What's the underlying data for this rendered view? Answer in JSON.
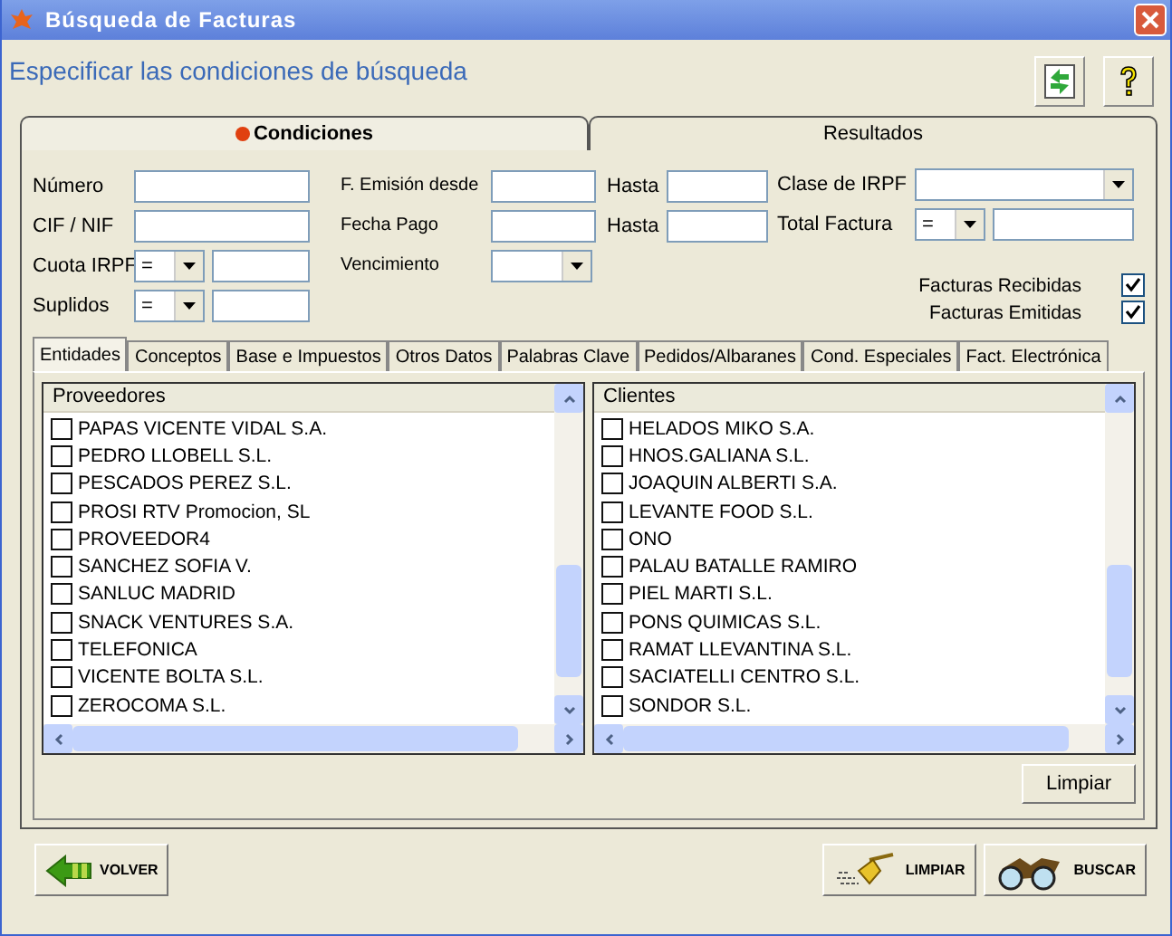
{
  "window": {
    "title": "Búsqueda de Facturas"
  },
  "header": {
    "title": "Especificar las condiciones de búsqueda"
  },
  "tabs": [
    {
      "label": "Condiciones",
      "selected": true
    },
    {
      "label": "Resultados",
      "selected": false
    }
  ],
  "criteria": {
    "column_1": [
      {
        "label": "Número",
        "kind": "text"
      },
      {
        "label": "CIF / NIF",
        "kind": "text"
      },
      {
        "label": "Cuota IRPF",
        "kind": "operator",
        "operator": "="
      },
      {
        "label": "Suplidos",
        "kind": "operator",
        "operator": "="
      }
    ],
    "column_2": [
      {
        "label": "F. Emisión desde",
        "kind": "range",
        "to_label": "Hasta"
      },
      {
        "label": "Fecha Pago",
        "kind": "range",
        "to_label": "Hasta"
      },
      {
        "label": "Vencimiento",
        "kind": "dropdown"
      }
    ],
    "column_3": [
      {
        "label": "Clase de IRPF",
        "kind": "dropdown"
      },
      {
        "label": "Total Factura",
        "kind": "operator",
        "operator": "="
      }
    ],
    "checks": [
      {
        "label": "Facturas Recibidas",
        "checked": true
      },
      {
        "label": "Facturas Emitidas",
        "checked": true
      }
    ]
  },
  "subtabs": [
    {
      "label": "Entidades",
      "selected": true
    },
    {
      "label": "Conceptos",
      "selected": false
    },
    {
      "label": "Base e Impuestos",
      "selected": false
    },
    {
      "label": "Otros Datos",
      "selected": false
    },
    {
      "label": "Palabras Clave",
      "selected": false
    },
    {
      "label": "Pedidos/Albaranes",
      "selected": false
    },
    {
      "label": "Cond. Especiales",
      "selected": false
    },
    {
      "label": "Fact. Electrónica",
      "selected": false
    }
  ],
  "lists": [
    {
      "header": "Proveedores",
      "items": [
        {
          "label": "PAPAS VICENTE VIDAL S.A.",
          "checked": false
        },
        {
          "label": "PEDRO LLOBELL S.L.",
          "checked": false
        },
        {
          "label": "PESCADOS PEREZ S.L.",
          "checked": false
        },
        {
          "label": "PROSI RTV Promocion, SL",
          "checked": false
        },
        {
          "label": "PROVEEDOR4",
          "checked": false
        },
        {
          "label": "SANCHEZ  SOFIA V.",
          "checked": false
        },
        {
          "label": "SANLUC MADRID",
          "checked": false
        },
        {
          "label": "SNACK VENTURES S.A.",
          "checked": false
        },
        {
          "label": "TELEFONICA",
          "checked": false
        },
        {
          "label": "VICENTE BOLTA S.L.",
          "checked": false
        },
        {
          "label": "ZEROCOMA S.L.",
          "checked": false
        }
      ]
    },
    {
      "header": "Clientes",
      "items": [
        {
          "label": "HELADOS MIKO S.A.",
          "checked": false
        },
        {
          "label": "HNOS.GALIANA S.L.",
          "checked": false
        },
        {
          "label": "JOAQUIN ALBERTI S.A.",
          "checked": false
        },
        {
          "label": "LEVANTE FOOD S.L.",
          "checked": false
        },
        {
          "label": "ONO",
          "checked": false
        },
        {
          "label": "PALAU BATALLE  RAMIRO",
          "checked": false
        },
        {
          "label": "PIEL MARTI S.L.",
          "checked": false
        },
        {
          "label": "PONS QUIMICAS S.L.",
          "checked": false
        },
        {
          "label": "RAMAT LLEVANTINA S.L.",
          "checked": false
        },
        {
          "label": "SACIATELLI CENTRO  S.L.",
          "checked": false
        },
        {
          "label": "SONDOR S.L.",
          "checked": false
        }
      ]
    }
  ],
  "clear_lists_button": "Limpiar",
  "buttons": [
    {
      "label": "VOLVER",
      "kind": "back"
    },
    {
      "label": "LIMPIAR",
      "kind": "clear"
    },
    {
      "label": "BUSCAR",
      "kind": "search"
    }
  ]
}
